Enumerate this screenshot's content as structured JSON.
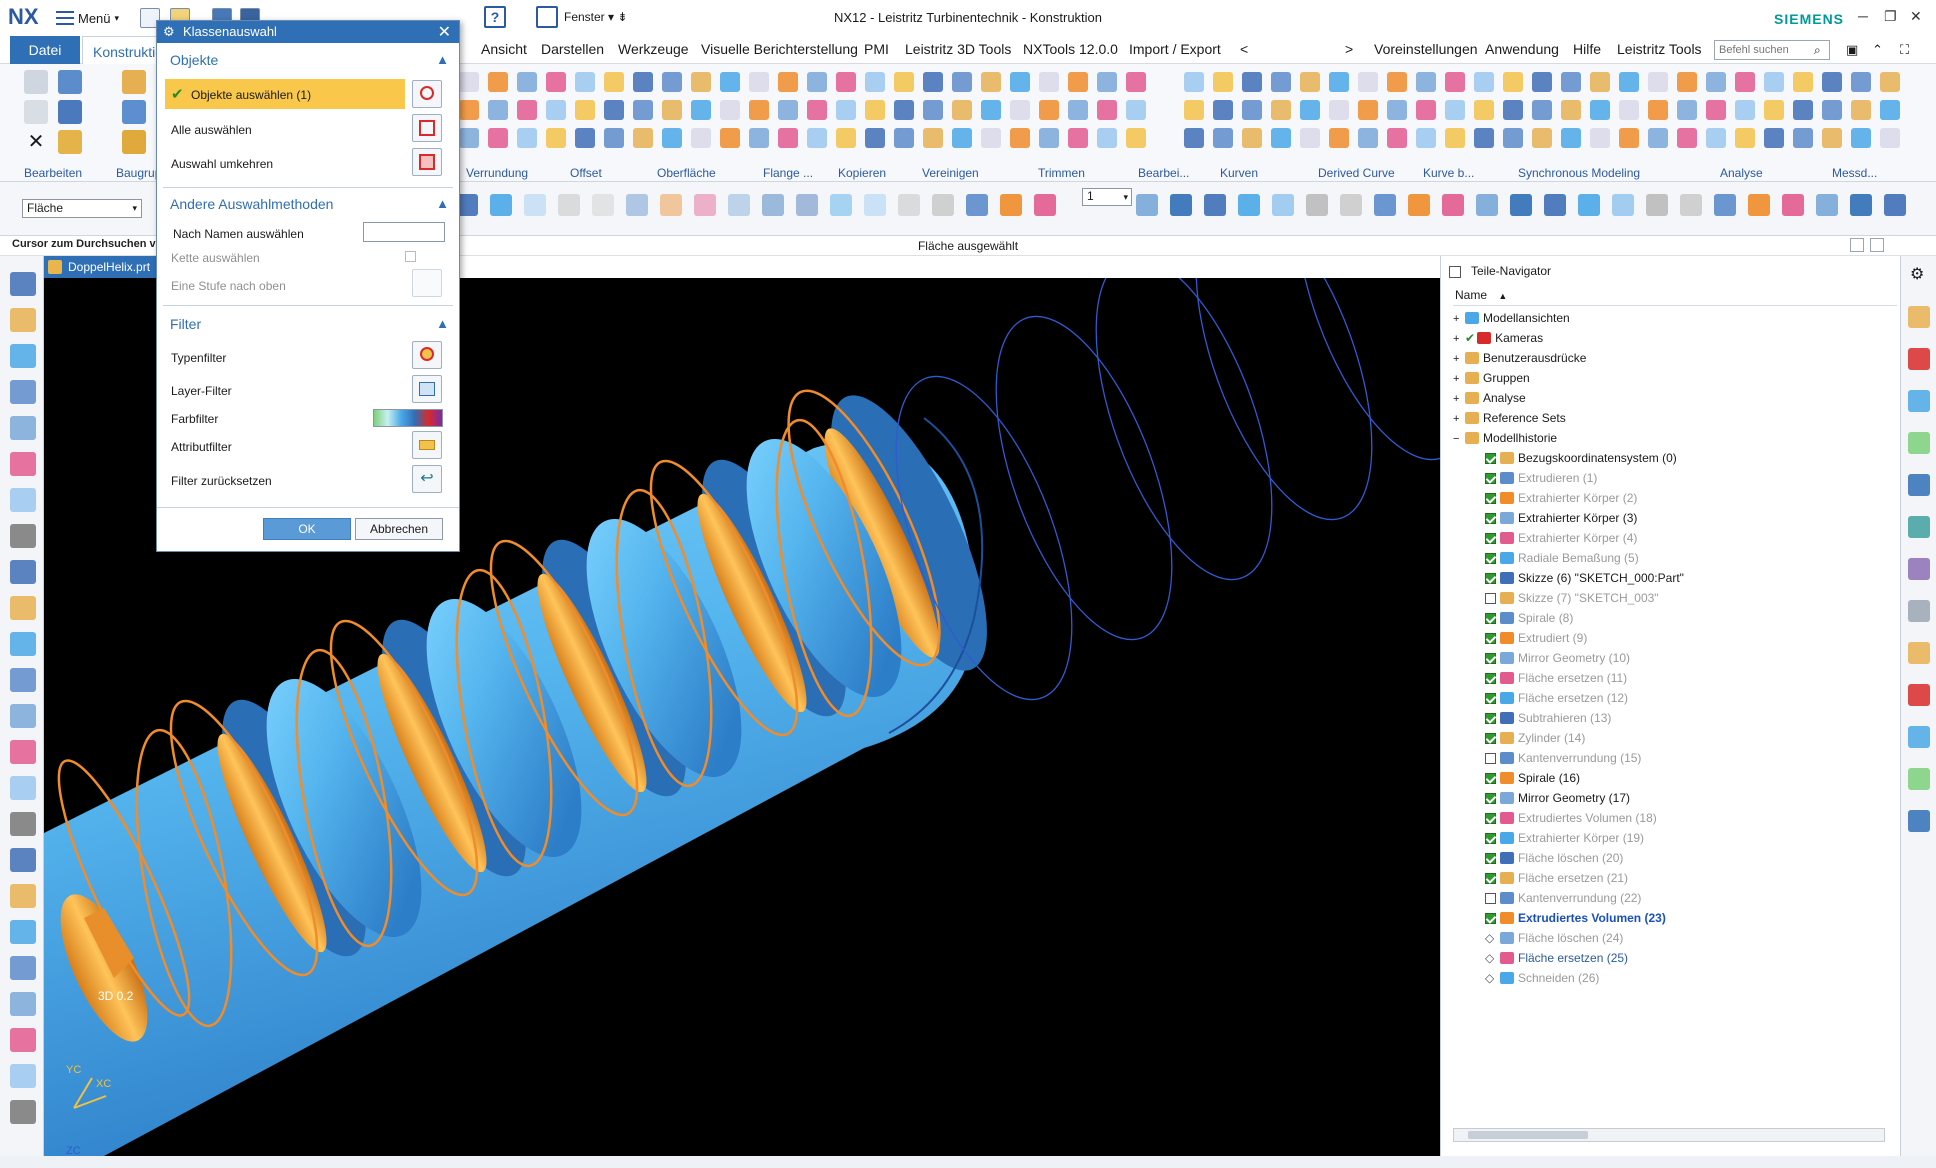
{
  "app": {
    "logo": "NX",
    "title": "NX12 - Leistritz Turbinentechnik - Konstruktion",
    "brand": "SIEMENS",
    "menu_label": "Menü",
    "fenster_label": "Fenster"
  },
  "menubar": {
    "datei": "Datei",
    "konstruktion": "Konstruktic",
    "tabs": [
      "Ansicht",
      "Darstellen",
      "Werkzeuge",
      "Visuelle Berichterstellung",
      "PMI",
      "Leistritz 3D Tools",
      "NXTools 12.0.0",
      "Import / Export",
      "<",
      ">",
      "Voreinstellungen",
      "Anwendung",
      "Hilfe",
      "Leistritz Tools"
    ],
    "search_placeholder": "Befehl suchen"
  },
  "ribbon": {
    "groups": [
      "Bearbeiten",
      "Baugrup",
      "Verrundung",
      "Offset",
      "Oberfläche",
      "Flange ...",
      "Kopieren",
      "Vereinigen",
      "Trimmen",
      "Bearbei...",
      "Kurven",
      "Derived Curve",
      "Kurve b...",
      "Synchronous Modeling",
      "Analyse",
      "Messd..."
    ]
  },
  "toolbar2": {
    "filter_value": "Fläche",
    "layer_value": "1"
  },
  "status": {
    "cursor_hint": "Cursor zum Durchsuchen vo",
    "message": "Fläche ausgewählt"
  },
  "document": {
    "tab": "DoppelHelix.prt"
  },
  "viewport": {
    "label_3d": "3D 0.2",
    "axis_yc": "YC",
    "axis_xc": "XC",
    "axis_zc": "ZC"
  },
  "dialog": {
    "title": "Klassenauswahl",
    "sections": {
      "objekte": "Objekte",
      "andere": "Andere Auswahlmethoden",
      "filter": "Filter"
    },
    "objekte_rows": [
      "Objekte auswählen (1)",
      "Alle auswählen",
      "Auswahl umkehren"
    ],
    "andere_rows": [
      "Nach Namen auswählen",
      "Kette auswählen",
      "Eine Stufe nach oben"
    ],
    "filter_rows": [
      "Typenfilter",
      "Layer-Filter",
      "Farbfilter",
      "Attributfilter",
      "Filter zurücksetzen"
    ],
    "ok": "OK",
    "cancel": "Abbrechen"
  },
  "navigator": {
    "title": "Teile-Navigator",
    "column": "Name",
    "top_items": [
      "Modellansichten",
      "Kameras",
      "Benutzerausdrücke",
      "Gruppen",
      "Analyse",
      "Reference Sets",
      "Modellhistorie"
    ],
    "history": [
      {
        "label": "Bezugskoordinatensystem (0)",
        "checked": true,
        "style": "normal"
      },
      {
        "label": "Extrudieren (1)",
        "checked": true,
        "style": "gray"
      },
      {
        "label": "Extrahierter Körper (2)",
        "checked": true,
        "style": "gray"
      },
      {
        "label": "Extrahierter Körper (3)",
        "checked": true,
        "style": "normal"
      },
      {
        "label": "Extrahierter Körper (4)",
        "checked": true,
        "style": "gray"
      },
      {
        "label": "Radiale Bemaßung (5)",
        "checked": true,
        "style": "gray"
      },
      {
        "label": "Skizze (6) \"SKETCH_000:Part\"",
        "checked": true,
        "style": "normal"
      },
      {
        "label": "Skizze (7) \"SKETCH_003\"",
        "checked": false,
        "style": "gray"
      },
      {
        "label": "Spirale (8)",
        "checked": true,
        "style": "gray"
      },
      {
        "label": "Extrudiert (9)",
        "checked": true,
        "style": "gray"
      },
      {
        "label": "Mirror Geometry (10)",
        "checked": true,
        "style": "gray"
      },
      {
        "label": "Fläche ersetzen (11)",
        "checked": true,
        "style": "gray"
      },
      {
        "label": "Fläche ersetzen (12)",
        "checked": true,
        "style": "gray"
      },
      {
        "label": "Subtrahieren (13)",
        "checked": true,
        "style": "gray"
      },
      {
        "label": "Zylinder (14)",
        "checked": true,
        "style": "gray"
      },
      {
        "label": "Kantenverrundung (15)",
        "checked": false,
        "style": "gray"
      },
      {
        "label": "Spirale (16)",
        "checked": true,
        "style": "normal"
      },
      {
        "label": "Mirror Geometry (17)",
        "checked": true,
        "style": "normal"
      },
      {
        "label": "Extrudiertes Volumen (18)",
        "checked": true,
        "style": "gray"
      },
      {
        "label": "Extrahierter Körper (19)",
        "checked": true,
        "style": "gray"
      },
      {
        "label": "Fläche löschen (20)",
        "checked": true,
        "style": "gray"
      },
      {
        "label": "Fläche ersetzen (21)",
        "checked": true,
        "style": "gray"
      },
      {
        "label": "Kantenverrundung (22)",
        "checked": false,
        "style": "gray"
      },
      {
        "label": "Extrudiertes Volumen (23)",
        "checked": true,
        "style": "bold"
      },
      {
        "label": "Fläche löschen (24)",
        "checked": null,
        "style": "gray"
      },
      {
        "label": "Fläche ersetzen (25)",
        "checked": null,
        "style": "blue"
      },
      {
        "label": "Schneiden (26)",
        "checked": null,
        "style": "gray"
      }
    ]
  },
  "colors": {
    "accent": "#2f6fb6",
    "selection": "#f9c84b",
    "body": "#4aa8e8",
    "helix": "#f08c2a",
    "brand": "#009999"
  }
}
